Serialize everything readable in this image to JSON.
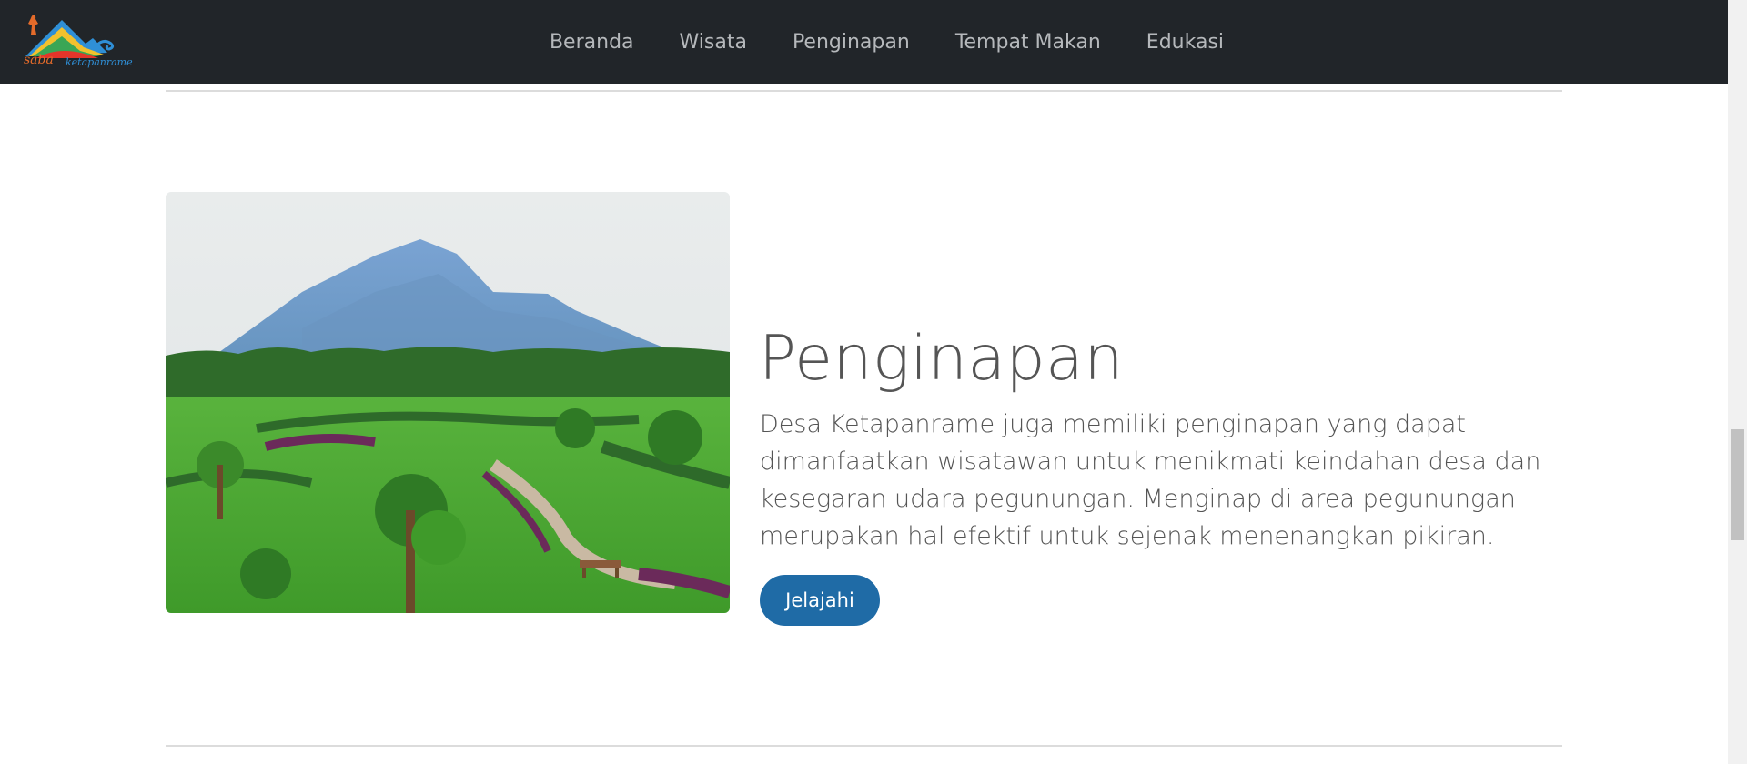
{
  "logo": {
    "text": "saba",
    "subtext": "ketapanrame"
  },
  "nav": {
    "items": [
      {
        "label": "Beranda"
      },
      {
        "label": "Wisata"
      },
      {
        "label": "Penginapan"
      },
      {
        "label": "Tempat Makan"
      },
      {
        "label": "Edukasi"
      }
    ]
  },
  "section": {
    "title": "Penginapan",
    "description": "Desa Ketapanrame juga memiliki penginapan yang dapat dimanfaatkan wisatawan untuk menikmati keindahan desa dan kesegaran udara pegunungan. Menginap di area pegunungan merupakan hal efektif untuk sejenak menenangkan pikiran.",
    "button_label": "Jelajahi"
  },
  "colors": {
    "navbar": "#212529",
    "button": "#1f6ba6",
    "text": "#555555"
  }
}
